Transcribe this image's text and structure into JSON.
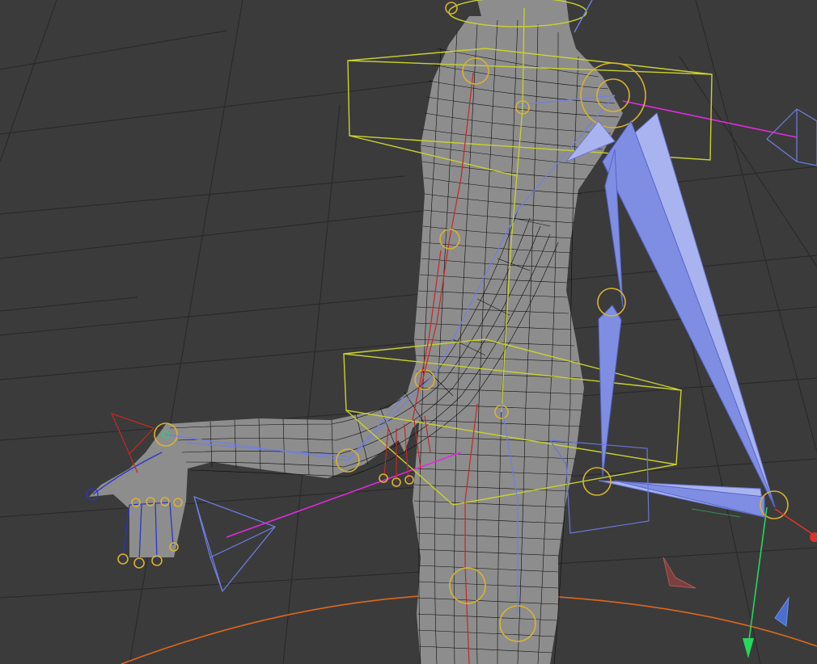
{
  "viewport": {
    "background": "#3b3b3b",
    "grid_color": "#2a2a2a",
    "mesh_color": "#0c0c0c",
    "bone_color": "#7f8ee2",
    "controller_color": "#c9d12d",
    "joint_ring_color": "#d9b232",
    "ik_line_color": "#e22ae0",
    "axis_y_color": "#27d65c",
    "axis_x_color": "#e0302a",
    "floor_ring_color": "#e1671d"
  },
  "icons": {
    "camera_gizmo": "camera-frustum-icon",
    "axis_gizmo": "xyz-axis-icon"
  }
}
